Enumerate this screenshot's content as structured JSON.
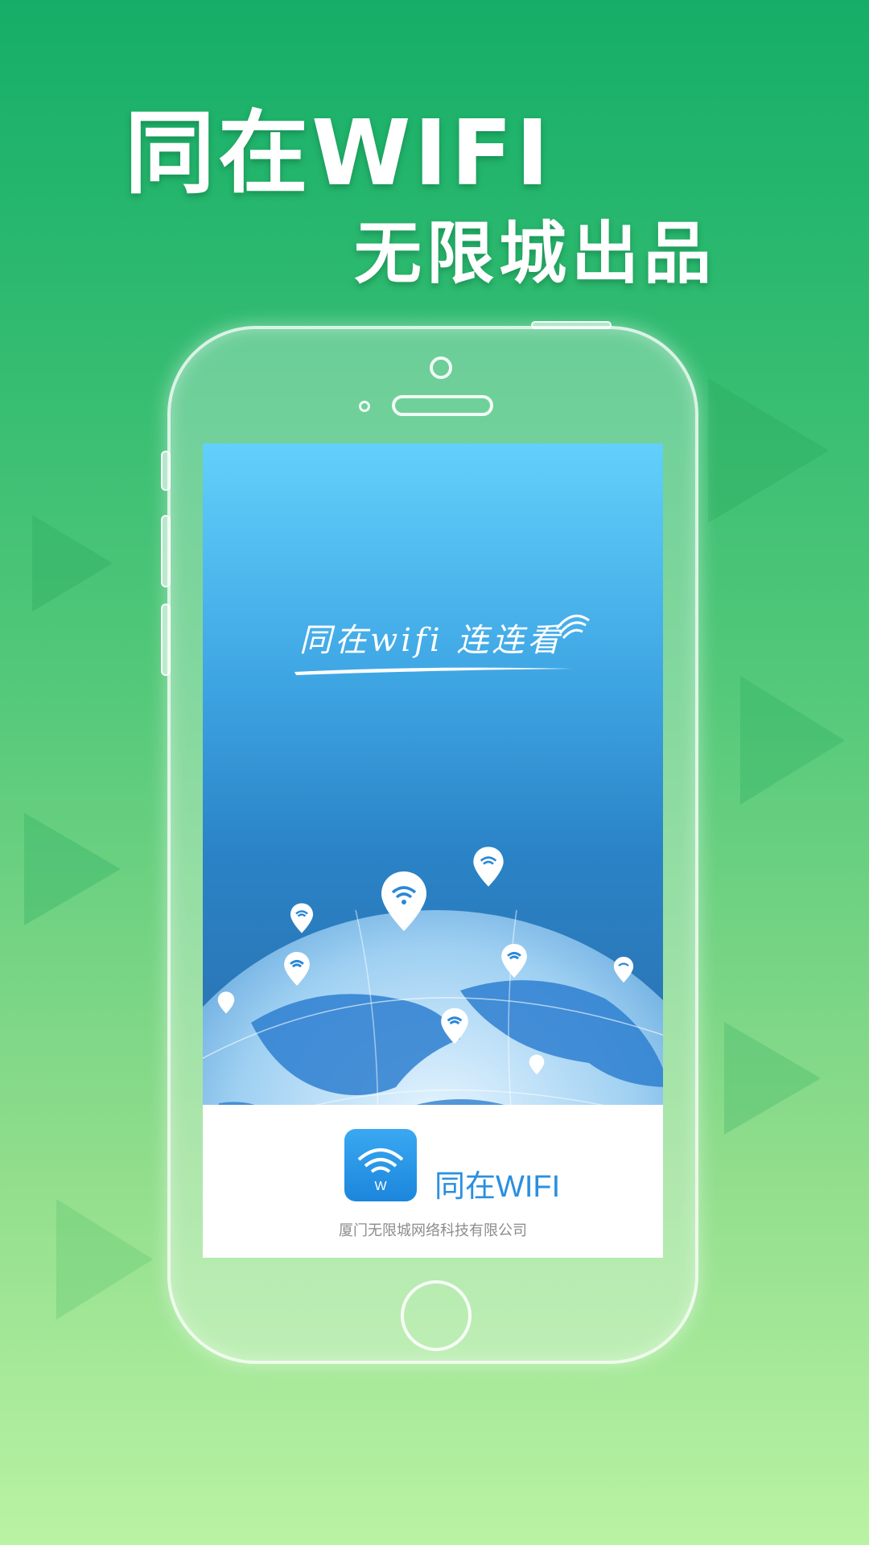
{
  "headline": {
    "title": "同在WIFI",
    "subtitle": "无限城出品"
  },
  "splash": {
    "tagline": "同在wifi 连连看"
  },
  "footer": {
    "app_name": "同在WIFI",
    "app_icon_letter": "W",
    "company": "厦门无限城网络科技有限公司"
  },
  "colors": {
    "background_top": "#15ae68",
    "background_bottom": "#b9f3a3",
    "sky_top": "#62d0fb",
    "sky_bottom": "#2c6fae",
    "brand_blue": "#2b8fe0"
  },
  "icons": [
    "wifi-icon",
    "map-pin-icon",
    "globe-icon",
    "home-button-icon"
  ]
}
